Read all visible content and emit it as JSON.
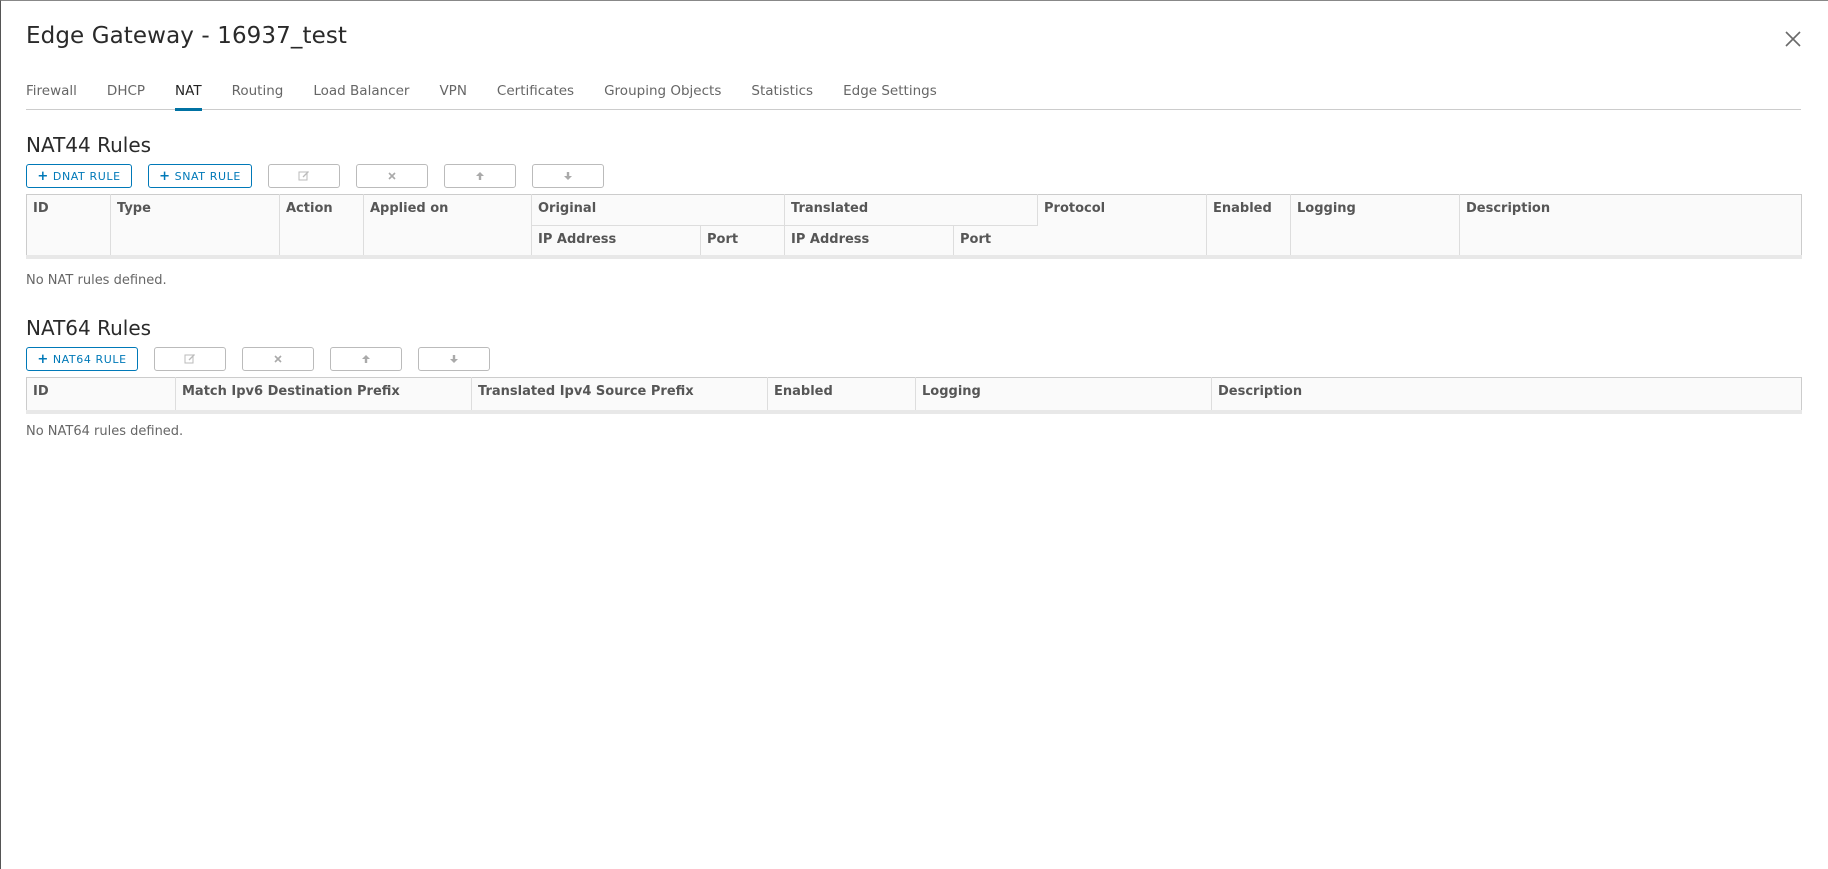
{
  "title": "Edge Gateway - 16937_test",
  "tabs": [
    {
      "label": "Firewall"
    },
    {
      "label": "DHCP"
    },
    {
      "label": "NAT"
    },
    {
      "label": "Routing"
    },
    {
      "label": "Load Balancer"
    },
    {
      "label": "VPN"
    },
    {
      "label": "Certificates"
    },
    {
      "label": "Grouping Objects"
    },
    {
      "label": "Statistics"
    },
    {
      "label": "Edge Settings"
    }
  ],
  "active_tab": "NAT",
  "nat44": {
    "title": "NAT44 Rules",
    "buttons": {
      "dnat": "DNAT RULE",
      "snat": "SNAT RULE"
    },
    "columns": {
      "id": "ID",
      "type": "Type",
      "action": "Action",
      "applied_on": "Applied on",
      "original": "Original",
      "translated": "Translated",
      "orig_ip": "IP Address",
      "orig_port": "Port",
      "trans_ip": "IP Address",
      "trans_port": "Port",
      "protocol": "Protocol",
      "enabled": "Enabled",
      "logging": "Logging",
      "description": "Description"
    },
    "empty": "No NAT rules defined."
  },
  "nat64": {
    "title": "NAT64 Rules",
    "buttons": {
      "add": "NAT64 RULE"
    },
    "columns": {
      "id": "ID",
      "match": "Match Ipv6 Destination Prefix",
      "translated": "Translated Ipv4 Source Prefix",
      "enabled": "Enabled",
      "logging": "Logging",
      "description": "Description"
    },
    "empty": "No NAT64 rules defined."
  },
  "colors": {
    "accent": "#0079b8",
    "tab_underline": "#0072a3"
  }
}
